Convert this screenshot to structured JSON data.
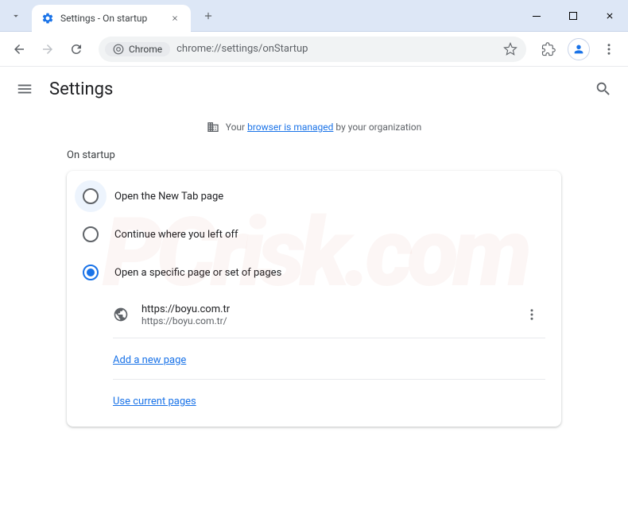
{
  "window": {
    "tab_title": "Settings - On startup"
  },
  "toolbar": {
    "chrome_chip": "Chrome",
    "url": "chrome://settings/onStartup"
  },
  "header": {
    "title": "Settings"
  },
  "managed": {
    "prefix": "Your",
    "link": "browser is managed",
    "suffix": "by your organization"
  },
  "section": {
    "label": "On startup"
  },
  "options": {
    "new_tab": "Open the New Tab page",
    "continue": "Continue where you left off",
    "specific": "Open a specific page or set of pages"
  },
  "startup_page": {
    "title": "https://boyu.com.tr",
    "url": "https://boyu.com.tr/"
  },
  "links": {
    "add_page": "Add a new page",
    "use_current": "Use current pages"
  }
}
